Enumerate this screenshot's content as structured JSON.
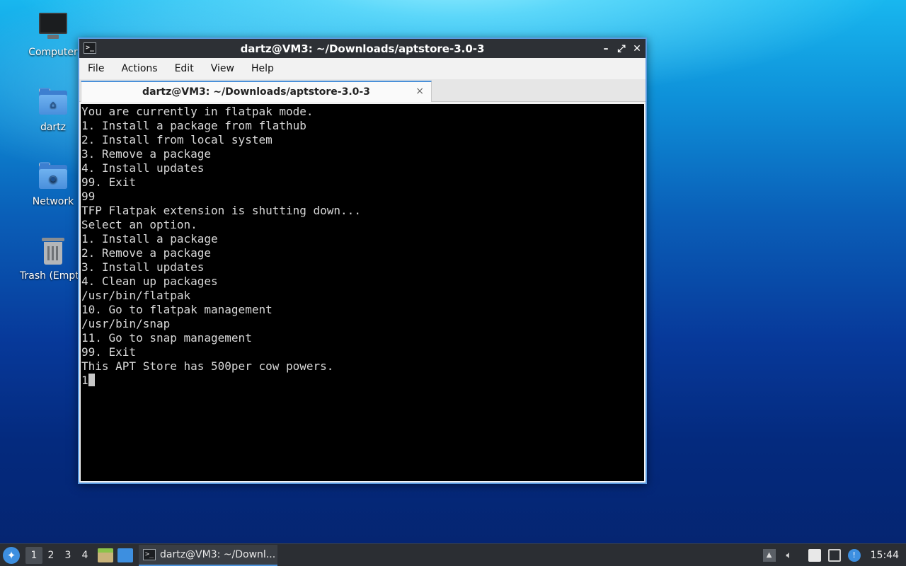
{
  "desktop": {
    "icons": [
      {
        "label": "Computer"
      },
      {
        "label": "dartz"
      },
      {
        "label": "Network"
      },
      {
        "label": "Trash (Empty)"
      }
    ]
  },
  "window": {
    "title": "dartz@VM3: ~/Downloads/aptstore-3.0-3",
    "controls": {
      "minimize": "–",
      "maximize": "⤢",
      "close": "✕"
    },
    "menu": [
      "File",
      "Actions",
      "Edit",
      "View",
      "Help"
    ],
    "tab": {
      "label": "dartz@VM3: ~/Downloads/aptstore-3.0-3",
      "close": "×"
    }
  },
  "terminal": {
    "lines": [
      "You are currently in flatpak mode.",
      "1. Install a package from flathub",
      "2. Install from local system",
      "3. Remove a package",
      "4. Install updates",
      "99. Exit",
      "99",
      "TFP Flatpak extension is shutting down...",
      "Select an option.",
      "1. Install a package",
      "2. Remove a package",
      "3. Install updates",
      "4. Clean up packages",
      "/usr/bin/flatpak",
      "10. Go to flatpak management",
      "/usr/bin/snap",
      "11. Go to snap management",
      "99. Exit",
      "This APT Store has 500per cow powers."
    ],
    "input": "1"
  },
  "taskbar": {
    "workspaces": [
      "1",
      "2",
      "3",
      "4"
    ],
    "active_workspace": "1",
    "task_label": "dartz@VM3: ~/Downl...",
    "clock": "15:44"
  }
}
